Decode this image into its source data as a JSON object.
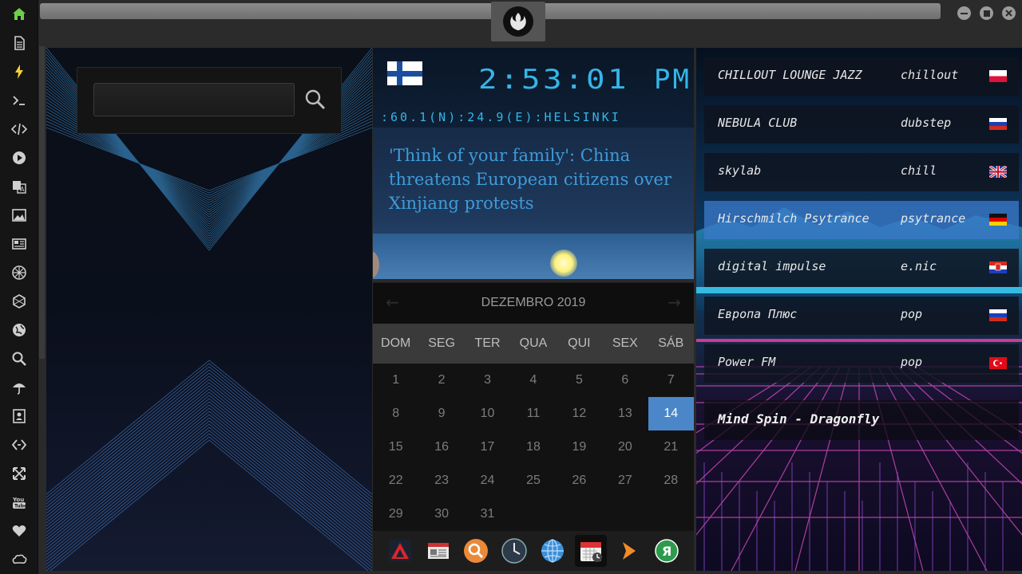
{
  "window": {
    "buttons": [
      "minimize",
      "maximize",
      "close"
    ]
  },
  "search": {
    "value": "",
    "placeholder": ""
  },
  "clock": {
    "country_flag": "finland",
    "time": "2:53:01",
    "ampm": "PM",
    "location": ":60.1(N):24.9(E):HELSINKI"
  },
  "news": {
    "headline": "'Think of your family': China threatens European citizens over Xinjiang protests"
  },
  "calendar": {
    "month_label": "DEZEMBRO 2019",
    "weekdays": [
      "DOM",
      "SEG",
      "TER",
      "QUA",
      "QUI",
      "SEX",
      "SÁB"
    ],
    "days": [
      "1",
      "2",
      "3",
      "4",
      "5",
      "6",
      "7",
      "8",
      "9",
      "10",
      "11",
      "12",
      "13",
      "14",
      "15",
      "16",
      "17",
      "18",
      "19",
      "20",
      "21",
      "22",
      "23",
      "24",
      "25",
      "26",
      "27",
      "28",
      "29",
      "30",
      "31"
    ],
    "today": "14",
    "prev_icon": "←",
    "next_icon": "→"
  },
  "radio": {
    "stations": [
      {
        "name": "CHILLOUT LOUNGE JAZZ",
        "genre": "chillout",
        "flag": "poland"
      },
      {
        "name": "NEBULA CLUB",
        "genre": "dubstep",
        "flag": "russia"
      },
      {
        "name": "skylab",
        "genre": "chill",
        "flag": "united-kingdom"
      },
      {
        "name": "Hirschmilch Psytrance",
        "genre": "psytrance",
        "flag": "germany"
      },
      {
        "name": "digital impulse",
        "genre": "e.nic",
        "flag": "croatia"
      },
      {
        "name": "Европа Плюс",
        "genre": "pop",
        "flag": "russia"
      },
      {
        "name": "Power FM",
        "genre": "pop",
        "flag": "turkey"
      }
    ],
    "active_index": 3,
    "now_playing": "Mind Spin - Dragonfly"
  },
  "colors": {
    "accent": "#4b86c8",
    "clock_cyan": "#34b6e8",
    "sidebar_active": "#6ccf4a",
    "sidebar_lightning": "#f5d033"
  }
}
